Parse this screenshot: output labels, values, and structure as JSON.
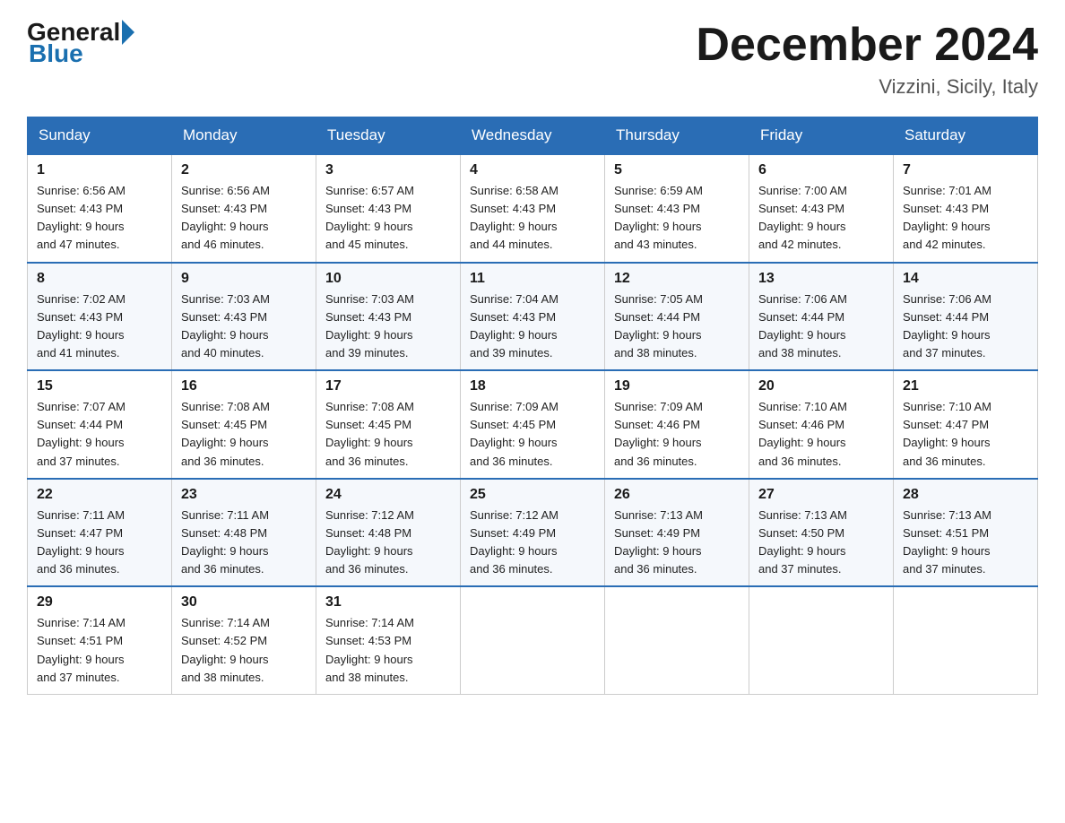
{
  "header": {
    "logo_general": "General",
    "logo_blue": "Blue",
    "month_title": "December 2024",
    "location": "Vizzini, Sicily, Italy"
  },
  "weekdays": [
    "Sunday",
    "Monday",
    "Tuesday",
    "Wednesday",
    "Thursday",
    "Friday",
    "Saturday"
  ],
  "weeks": [
    [
      {
        "day": "1",
        "sunrise": "6:56 AM",
        "sunset": "4:43 PM",
        "daylight": "9 hours and 47 minutes."
      },
      {
        "day": "2",
        "sunrise": "6:56 AM",
        "sunset": "4:43 PM",
        "daylight": "9 hours and 46 minutes."
      },
      {
        "day": "3",
        "sunrise": "6:57 AM",
        "sunset": "4:43 PM",
        "daylight": "9 hours and 45 minutes."
      },
      {
        "day": "4",
        "sunrise": "6:58 AM",
        "sunset": "4:43 PM",
        "daylight": "9 hours and 44 minutes."
      },
      {
        "day": "5",
        "sunrise": "6:59 AM",
        "sunset": "4:43 PM",
        "daylight": "9 hours and 43 minutes."
      },
      {
        "day": "6",
        "sunrise": "7:00 AM",
        "sunset": "4:43 PM",
        "daylight": "9 hours and 42 minutes."
      },
      {
        "day": "7",
        "sunrise": "7:01 AM",
        "sunset": "4:43 PM",
        "daylight": "9 hours and 42 minutes."
      }
    ],
    [
      {
        "day": "8",
        "sunrise": "7:02 AM",
        "sunset": "4:43 PM",
        "daylight": "9 hours and 41 minutes."
      },
      {
        "day": "9",
        "sunrise": "7:03 AM",
        "sunset": "4:43 PM",
        "daylight": "9 hours and 40 minutes."
      },
      {
        "day": "10",
        "sunrise": "7:03 AM",
        "sunset": "4:43 PM",
        "daylight": "9 hours and 39 minutes."
      },
      {
        "day": "11",
        "sunrise": "7:04 AM",
        "sunset": "4:43 PM",
        "daylight": "9 hours and 39 minutes."
      },
      {
        "day": "12",
        "sunrise": "7:05 AM",
        "sunset": "4:44 PM",
        "daylight": "9 hours and 38 minutes."
      },
      {
        "day": "13",
        "sunrise": "7:06 AM",
        "sunset": "4:44 PM",
        "daylight": "9 hours and 38 minutes."
      },
      {
        "day": "14",
        "sunrise": "7:06 AM",
        "sunset": "4:44 PM",
        "daylight": "9 hours and 37 minutes."
      }
    ],
    [
      {
        "day": "15",
        "sunrise": "7:07 AM",
        "sunset": "4:44 PM",
        "daylight": "9 hours and 37 minutes."
      },
      {
        "day": "16",
        "sunrise": "7:08 AM",
        "sunset": "4:45 PM",
        "daylight": "9 hours and 36 minutes."
      },
      {
        "day": "17",
        "sunrise": "7:08 AM",
        "sunset": "4:45 PM",
        "daylight": "9 hours and 36 minutes."
      },
      {
        "day": "18",
        "sunrise": "7:09 AM",
        "sunset": "4:45 PM",
        "daylight": "9 hours and 36 minutes."
      },
      {
        "day": "19",
        "sunrise": "7:09 AM",
        "sunset": "4:46 PM",
        "daylight": "9 hours and 36 minutes."
      },
      {
        "day": "20",
        "sunrise": "7:10 AM",
        "sunset": "4:46 PM",
        "daylight": "9 hours and 36 minutes."
      },
      {
        "day": "21",
        "sunrise": "7:10 AM",
        "sunset": "4:47 PM",
        "daylight": "9 hours and 36 minutes."
      }
    ],
    [
      {
        "day": "22",
        "sunrise": "7:11 AM",
        "sunset": "4:47 PM",
        "daylight": "9 hours and 36 minutes."
      },
      {
        "day": "23",
        "sunrise": "7:11 AM",
        "sunset": "4:48 PM",
        "daylight": "9 hours and 36 minutes."
      },
      {
        "day": "24",
        "sunrise": "7:12 AM",
        "sunset": "4:48 PM",
        "daylight": "9 hours and 36 minutes."
      },
      {
        "day": "25",
        "sunrise": "7:12 AM",
        "sunset": "4:49 PM",
        "daylight": "9 hours and 36 minutes."
      },
      {
        "day": "26",
        "sunrise": "7:13 AM",
        "sunset": "4:49 PM",
        "daylight": "9 hours and 36 minutes."
      },
      {
        "day": "27",
        "sunrise": "7:13 AM",
        "sunset": "4:50 PM",
        "daylight": "9 hours and 37 minutes."
      },
      {
        "day": "28",
        "sunrise": "7:13 AM",
        "sunset": "4:51 PM",
        "daylight": "9 hours and 37 minutes."
      }
    ],
    [
      {
        "day": "29",
        "sunrise": "7:14 AM",
        "sunset": "4:51 PM",
        "daylight": "9 hours and 37 minutes."
      },
      {
        "day": "30",
        "sunrise": "7:14 AM",
        "sunset": "4:52 PM",
        "daylight": "9 hours and 38 minutes."
      },
      {
        "day": "31",
        "sunrise": "7:14 AM",
        "sunset": "4:53 PM",
        "daylight": "9 hours and 38 minutes."
      },
      null,
      null,
      null,
      null
    ]
  ],
  "labels": {
    "sunrise": "Sunrise:",
    "sunset": "Sunset:",
    "daylight": "Daylight:"
  }
}
